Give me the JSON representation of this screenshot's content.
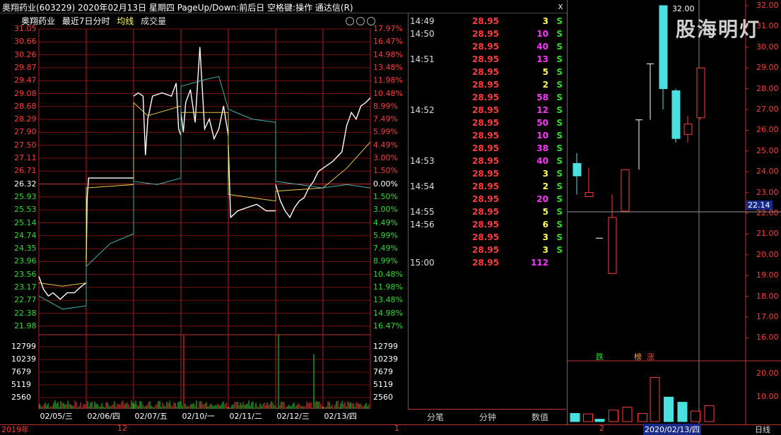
{
  "window": {
    "title": "奥翔药业(603229)  2020年02月13日  星期四  PageUp/Down:前后日  空格键:操作  通达信(R)",
    "close_glyph": "x"
  },
  "chart_header": {
    "name": "奥翔药业",
    "period": "最近7日分时",
    "avg_label": "均线",
    "vol_label": "成交量"
  },
  "price_axis_left": [
    "31.05",
    "30.66",
    "30.26",
    "29.87",
    "29.47",
    "29.08",
    "28.68",
    "28.29",
    "27.90",
    "27.50",
    "27.11",
    "26.71",
    "26.32",
    "25.93",
    "25.53",
    "25.14",
    "24.74",
    "24.35",
    "23.96",
    "23.56",
    "23.17",
    "22.77",
    "22.38",
    "21.98"
  ],
  "pct_axis_right": [
    "17.97%",
    "16.47%",
    "14.98%",
    "13.48%",
    "11.98%",
    "10.48%",
    "8.99%",
    "7.49%",
    "5.99%",
    "4.49%",
    "3.00%",
    "1.50%",
    "0.00%",
    "1.50%",
    "3.00%",
    "4.49%",
    "5.99%",
    "7.49%",
    "8.99%",
    "10.48%",
    "11.98%",
    "13.48%",
    "14.98%",
    "16.47%"
  ],
  "volume_axis": [
    "12799",
    "10239",
    "7679",
    "5119",
    "2560"
  ],
  "date_axis": [
    "02/05/三",
    "02/06/四",
    "02/07/五",
    "02/10/一",
    "02/11/二",
    "02/12/三",
    "02/13/四"
  ],
  "bottom_left": {
    "year": "2019年",
    "month": "12",
    "marker": "1"
  },
  "trades": [
    {
      "time": "14:49",
      "price": "28.95",
      "vol": "3",
      "flag": "S",
      "vcolor": "yellow"
    },
    {
      "time": "14:50",
      "price": "28.95",
      "vol": "10",
      "flag": "S",
      "vcolor": "magenta"
    },
    {
      "time": "",
      "price": "28.95",
      "vol": "40",
      "flag": "S",
      "vcolor": "magenta"
    },
    {
      "time": "14:51",
      "price": "28.95",
      "vol": "13",
      "flag": "S",
      "vcolor": "magenta"
    },
    {
      "time": "",
      "price": "28.95",
      "vol": "5",
      "flag": "S",
      "vcolor": "yellow"
    },
    {
      "time": "",
      "price": "28.95",
      "vol": "2",
      "flag": "S",
      "vcolor": "yellow"
    },
    {
      "time": "",
      "price": "28.95",
      "vol": "58",
      "flag": "S",
      "vcolor": "magenta"
    },
    {
      "time": "14:52",
      "price": "28.95",
      "vol": "12",
      "flag": "S",
      "vcolor": "magenta"
    },
    {
      "time": "",
      "price": "28.95",
      "vol": "50",
      "flag": "S",
      "vcolor": "magenta"
    },
    {
      "time": "",
      "price": "28.95",
      "vol": "10",
      "flag": "S",
      "vcolor": "magenta"
    },
    {
      "time": "",
      "price": "28.95",
      "vol": "38",
      "flag": "S",
      "vcolor": "magenta"
    },
    {
      "time": "14:53",
      "price": "28.95",
      "vol": "40",
      "flag": "S",
      "vcolor": "magenta"
    },
    {
      "time": "",
      "price": "28.95",
      "vol": "3",
      "flag": "S",
      "vcolor": "yellow"
    },
    {
      "time": "14:54",
      "price": "28.95",
      "vol": "2",
      "flag": "S",
      "vcolor": "yellow"
    },
    {
      "time": "",
      "price": "28.95",
      "vol": "20",
      "flag": "S",
      "vcolor": "magenta"
    },
    {
      "time": "14:55",
      "price": "28.95",
      "vol": "5",
      "flag": "S",
      "vcolor": "yellow"
    },
    {
      "time": "14:56",
      "price": "28.95",
      "vol": "6",
      "flag": "S",
      "vcolor": "yellow"
    },
    {
      "time": "",
      "price": "28.95",
      "vol": "3",
      "flag": "S",
      "vcolor": "yellow"
    },
    {
      "time": "",
      "price": "28.95",
      "vol": "3",
      "flag": "S",
      "vcolor": "yellow"
    },
    {
      "time": "15:00",
      "price": "28.95",
      "vol": "112",
      "flag": "",
      "vcolor": "magenta"
    }
  ],
  "tabs": [
    "分笔",
    "分钟",
    "数值"
  ],
  "kline": {
    "axis": [
      "32.00",
      "31.00",
      "30.00",
      "29.00",
      "28.00",
      "27.00",
      "26.00",
      "25.00",
      "24.00",
      "23.00",
      "22.00",
      "21.00",
      "20.00",
      "19.00",
      "18.00",
      "17.00",
      "16.00"
    ],
    "crosshair_value": "22.14",
    "high_label": "32.00",
    "watermark": "股海明灯",
    "markers": [
      "跌",
      "榜",
      "涨"
    ],
    "vol_axis": [
      "20.00",
      "10.00"
    ],
    "date_cursor": "2020/02/13/四",
    "bottom_label": "日线",
    "bottom_num": "2"
  },
  "colors": {
    "up": "#ff3b3b",
    "down": "#4be0e0",
    "grid": "#8b1a1a",
    "avg": "#ffe066",
    "price": "#ffffff"
  }
}
